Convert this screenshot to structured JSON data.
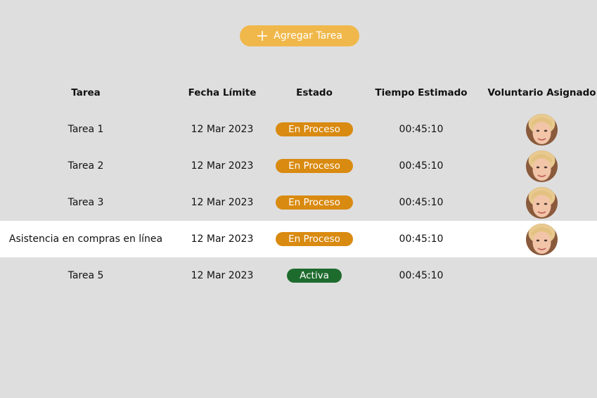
{
  "toolbar": {
    "add_label": "Agregar Tarea",
    "add_icon": "plus-icon"
  },
  "table": {
    "columns": [
      "Tarea",
      "Fecha Límite",
      "Estado",
      "Tiempo Estimado",
      "Voluntario Asignado"
    ],
    "rows": [
      {
        "task": "Tarea 1",
        "date": "12 Mar 2023",
        "status": "En Proceso",
        "time": "00:45:10",
        "has_avatar": true
      },
      {
        "task": "Tarea 2",
        "date": "12 Mar 2023",
        "status": "En Proceso",
        "time": "00:45:10",
        "has_avatar": true
      },
      {
        "task": "Tarea 3",
        "date": "12 Mar 2023",
        "status": "En Proceso",
        "time": "00:45:10",
        "has_avatar": true
      },
      {
        "task": "Asistencia en compras en línea",
        "date": "12 Mar 2023",
        "status": "En Proceso",
        "time": "00:45:10",
        "has_avatar": true,
        "selected": true
      },
      {
        "task": "Tarea 5",
        "date": "12 Mar 2023",
        "status": "Activa",
        "time": "00:45:10",
        "has_avatar": false
      }
    ]
  },
  "colors": {
    "background": "#dedede",
    "accent_button": "#f0b84a",
    "status_in_progress": "#d98a10",
    "status_active": "#1e6b2e",
    "selected_row": "#ffffff"
  }
}
